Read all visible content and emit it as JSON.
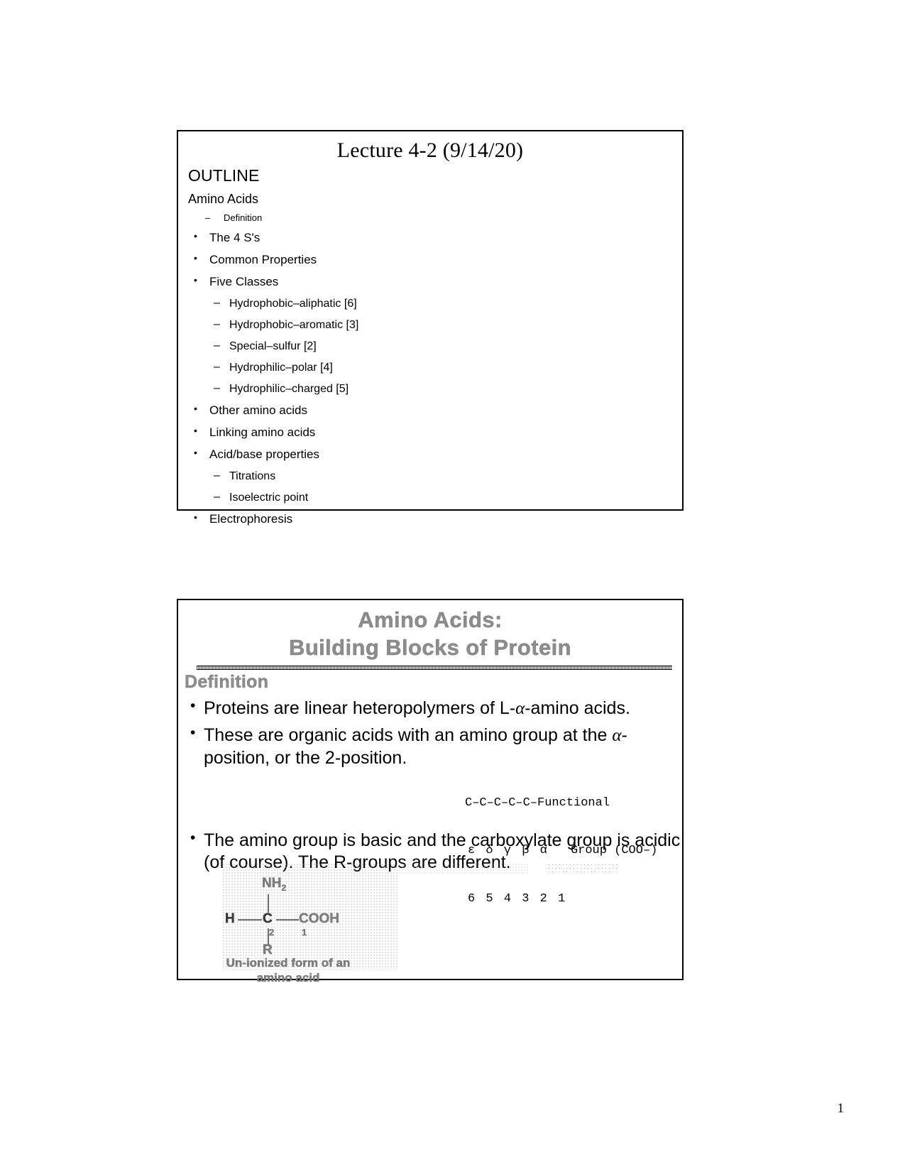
{
  "page": {
    "number": "1"
  },
  "slide1": {
    "title": "Lecture 4-2 (9/14/20)",
    "outline_label": "OUTLINE",
    "section_label": "Amino Acids",
    "sub_definition": "Definition",
    "dash_marker": "–",
    "bullet_marker": "•",
    "items": [
      {
        "level": 1,
        "text": "The 4 S's"
      },
      {
        "level": 1,
        "text": "Common Properties"
      },
      {
        "level": 1,
        "text": "Five Classes"
      },
      {
        "level": 2,
        "text": "Hydrophobic–aliphatic [6]"
      },
      {
        "level": 2,
        "text": "Hydrophobic–aromatic [3]"
      },
      {
        "level": 2,
        "text": "Special–sulfur  [2]"
      },
      {
        "level": 2,
        "text": "Hydrophilic–polar [4]"
      },
      {
        "level": 2,
        "text": "Hydrophilic–charged [5]"
      },
      {
        "level": 1,
        "text": "Other amino acids"
      },
      {
        "level": 1,
        "text": "Linking amino acids"
      },
      {
        "level": 1,
        "text": "Acid/base properties"
      },
      {
        "level": 2,
        "text": "Titrations"
      },
      {
        "level": 2,
        "text": "Isoelectric point"
      },
      {
        "level": 1,
        "text": "Electrophoresis"
      }
    ]
  },
  "slide2": {
    "title_line1": "Amino Acids:",
    "title_line2": "Building Blocks of Protein",
    "definition_heading": "Definition",
    "bullet_marker": "•",
    "bullets": {
      "b1_pre": "Proteins are linear heteropolymers of L-",
      "b1_alpha": "α",
      "b1_post": "-amino acids.",
      "b2_pre": "These are organic acids with an amino group at the ",
      "b2_alpha": "α",
      "b2_post": "-position, or the 2-position.",
      "b3": "The amino group is basic and the carboxylate group is acidic (of course).  The R-groups are different."
    },
    "chain_note": {
      "row1": "C–C–C–C–C–Functional",
      "row2_greek": "ε δ γ β α",
      "row2_group": "Group (COO–)",
      "row3_numbers": "6 5 4 3 2 1"
    },
    "structure": {
      "amino_group": "NH",
      "amino_subscript": "2",
      "left_atom": "H",
      "center_atom": "C",
      "carboxyl": "COOH",
      "center_number": "2",
      "carboxyl_number": "1",
      "r_group": "R",
      "caption_line1": "Un-ionized form of an",
      "caption_line2": "amino acid"
    }
  }
}
